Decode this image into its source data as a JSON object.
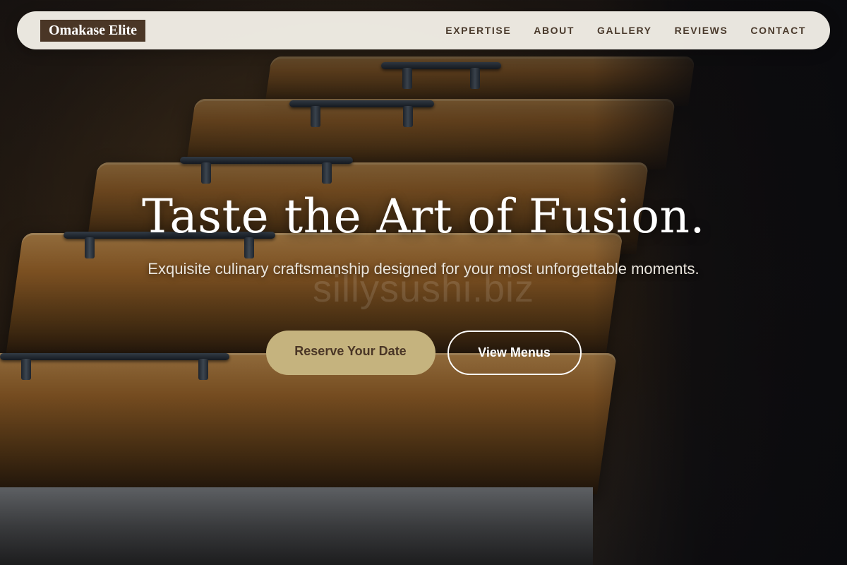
{
  "nav": {
    "logo": "Omakase Elite",
    "links": [
      "EXPERTISE",
      "ABOUT",
      "GALLERY",
      "REVIEWS",
      "CONTACT"
    ]
  },
  "hero": {
    "title": "Taste the Art of Fusion.",
    "subtitle": "Exquisite culinary craftsmanship designed for your most unforgettable moments.",
    "watermark": "sillysushi.biz",
    "primary_button": "Reserve Your Date",
    "secondary_button": "View Menus"
  },
  "colors": {
    "logo_bg": "#4a3626",
    "primary_button": "#c5b37e",
    "nav_bg": "#faf6ee"
  }
}
